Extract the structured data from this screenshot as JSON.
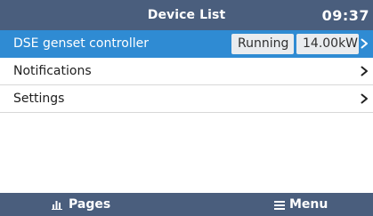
{
  "header": {
    "title": "Device List",
    "time": "09:37"
  },
  "list": {
    "items": [
      {
        "label": "DSE genset controller",
        "status": "Running",
        "value": "14.00kW",
        "selected": true,
        "chevron_icon": "chevron-right-icon"
      },
      {
        "label": "Notifications",
        "selected": false,
        "chevron_icon": "chevron-right-icon"
      },
      {
        "label": "Settings",
        "selected": false,
        "chevron_icon": "chevron-right-icon"
      }
    ]
  },
  "footer": {
    "pages_label": "Pages",
    "pages_icon": "bar-chart-icon",
    "menu_label": "Menu",
    "menu_icon": "hamburger-menu-icon"
  },
  "colors": {
    "bar_background": "#4a5e7d",
    "selection": "#2f8bd3",
    "badge_background": "#e9ecef",
    "text": "#202020"
  }
}
